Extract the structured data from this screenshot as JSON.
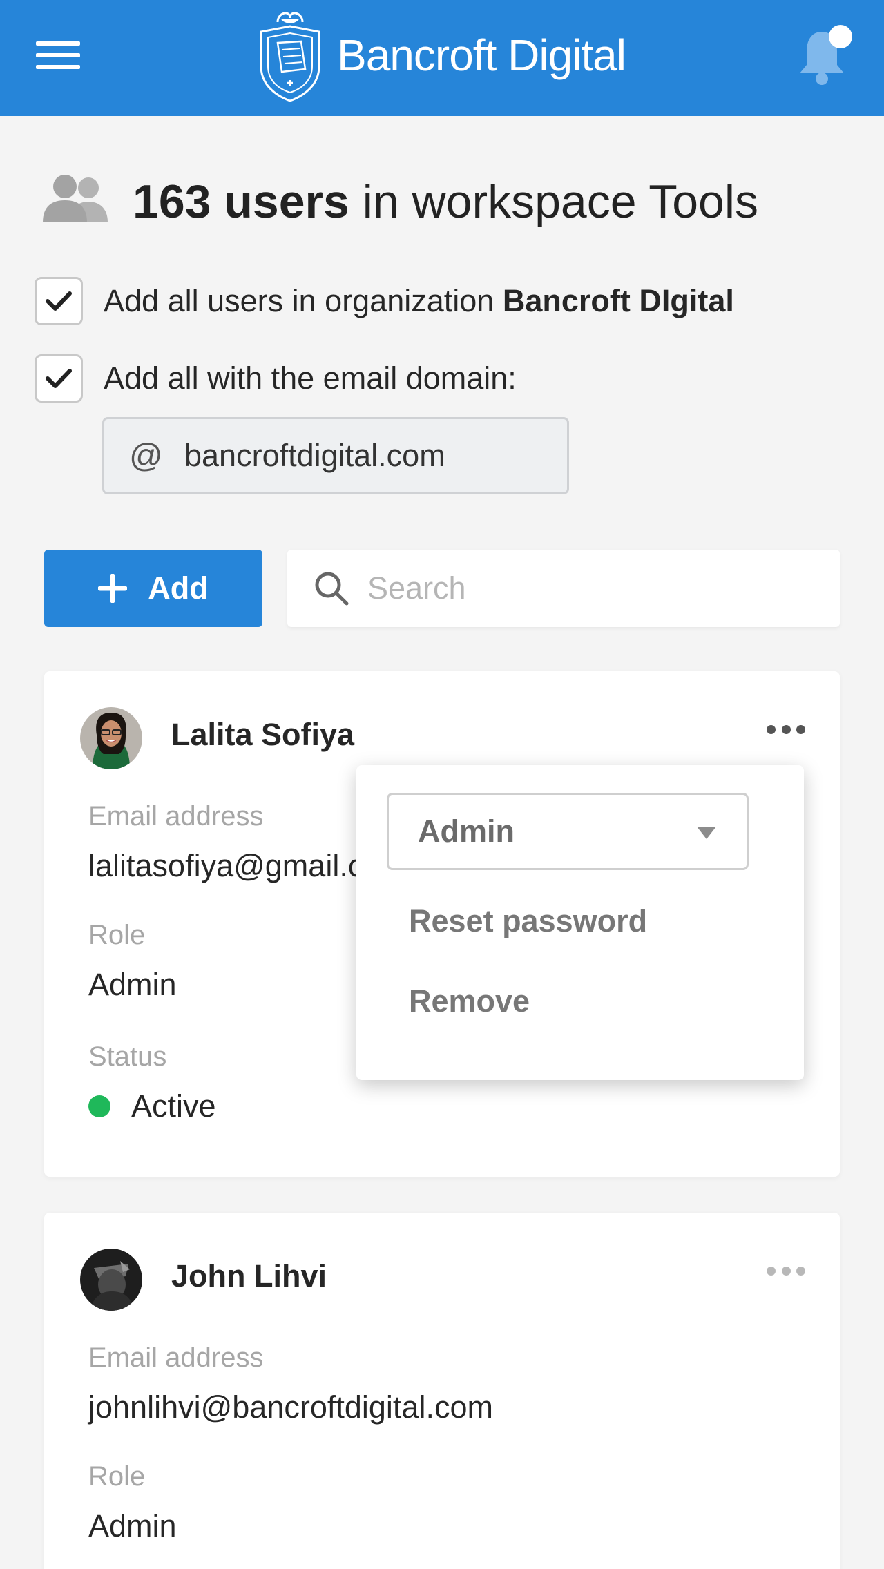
{
  "header": {
    "brand": "Bancroft Digital",
    "accent_color": "#2685d9",
    "menu_icon": "hamburger-menu-icon",
    "logo_icon": "crest-logo-icon",
    "notification_icon": "bell-icon",
    "has_unread": true
  },
  "title": {
    "count_users": "163 users",
    "rest": " in workspace Tools",
    "icon": "users-icon"
  },
  "options": {
    "org_checked": true,
    "org_label_prefix": "Add all users in organization ",
    "org_name": "Bancroft DIgital",
    "domain_checked": true,
    "domain_label": "Add all with the email domain:",
    "domain_prefix": "@",
    "domain_value": "bancroftdigital.com"
  },
  "toolbar": {
    "add_label": "Add",
    "search_placeholder": "Search"
  },
  "users": [
    {
      "name": "Lalita Sofiya",
      "email_label": "Email address",
      "email": "lalitasofiya@gmail.com",
      "role_label": "Role",
      "role": "Admin",
      "status_label": "Status",
      "status": "Active",
      "status_color": "#1fb85a"
    },
    {
      "name": "John Lihvi",
      "email_label": "Email address",
      "email": "johnlihvi@bancroftdigital.com",
      "role_label": "Role",
      "role": "Admin"
    }
  ],
  "popover": {
    "role_value": "Admin",
    "items": [
      "Reset password",
      "Remove"
    ]
  }
}
